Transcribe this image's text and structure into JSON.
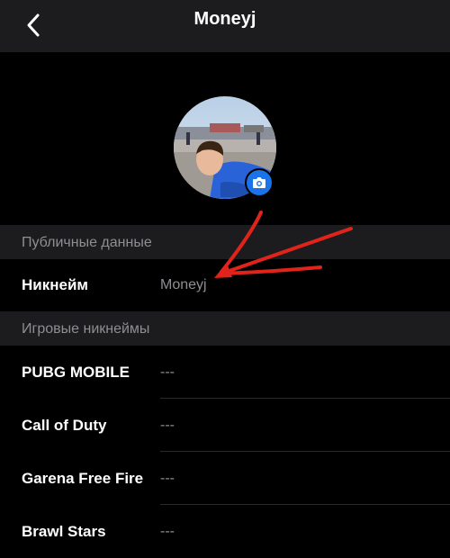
{
  "header": {
    "title": "Moneyj",
    "back_icon": "chevron-left-icon"
  },
  "profile": {
    "camera_icon": "camera-icon"
  },
  "public_section": {
    "title": "Публичные данные",
    "nickname_label": "Никнейм",
    "nickname_value": "Moneyj"
  },
  "games_section": {
    "title": "Игровые никнеймы",
    "items": [
      {
        "label": "PUBG MOBILE",
        "value": "---"
      },
      {
        "label": "Call of Duty",
        "value": "---"
      },
      {
        "label": "Garena Free Fire",
        "value": "---"
      },
      {
        "label": "Brawl Stars",
        "value": "---"
      }
    ]
  },
  "colors": {
    "background": "#000000",
    "section_bg": "#1c1c1e",
    "secondary_text": "#8e8e93",
    "accent": "#1a73e8",
    "annotation_arrow": "#e0231b"
  }
}
